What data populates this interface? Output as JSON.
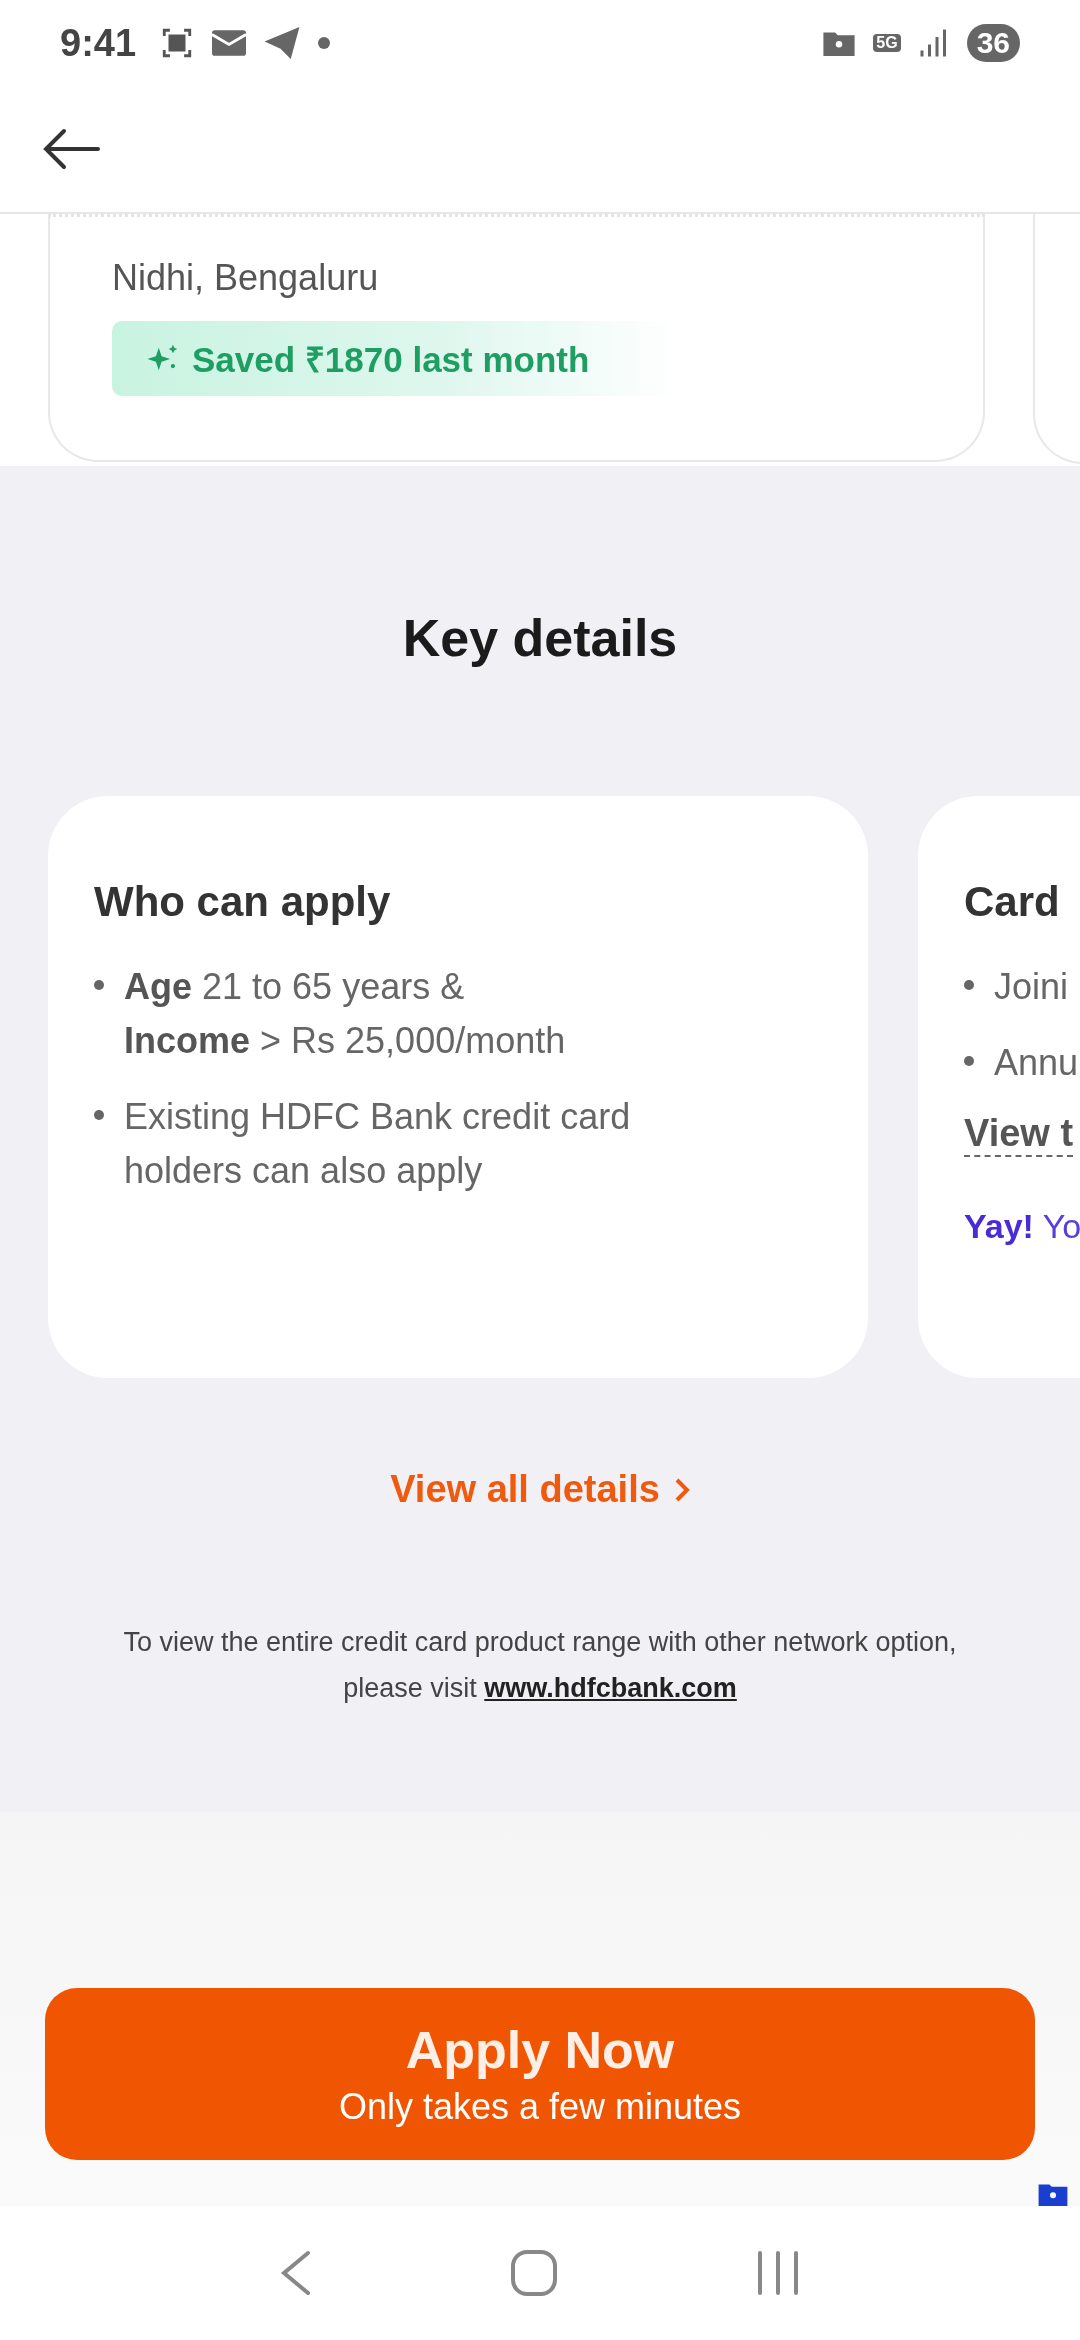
{
  "status_bar": {
    "time": "9:41",
    "network": "5G",
    "battery": "36"
  },
  "testimonial": {
    "name": "Nidhi, Bengaluru",
    "savings": "Saved ₹1870 last month"
  },
  "key_details": {
    "title": "Key details",
    "cards": [
      {
        "title": "Who can apply",
        "items": [
          {
            "lines": [
              "**Age** 21 to 65 years &",
              "**Income** > Rs 25,000/month"
            ]
          },
          {
            "lines": [
              "Existing HDFC Bank credit card",
              "holders can also apply"
            ]
          }
        ]
      },
      {
        "title": "Card",
        "items": [
          {
            "lines": [
              "Joini"
            ]
          },
          {
            "lines": [
              "Annu"
            ]
          }
        ],
        "link": "View t",
        "note": "**Yay!** Yo"
      }
    ],
    "view_all": "View all details"
  },
  "footer": {
    "text": "To view the entire credit card product range with other network option,",
    "prefix": "please visit",
    "link": "www.hdfcbank.com"
  },
  "apply_button": {
    "label": "Apply Now",
    "sublabel": "Only takes a few minutes"
  }
}
